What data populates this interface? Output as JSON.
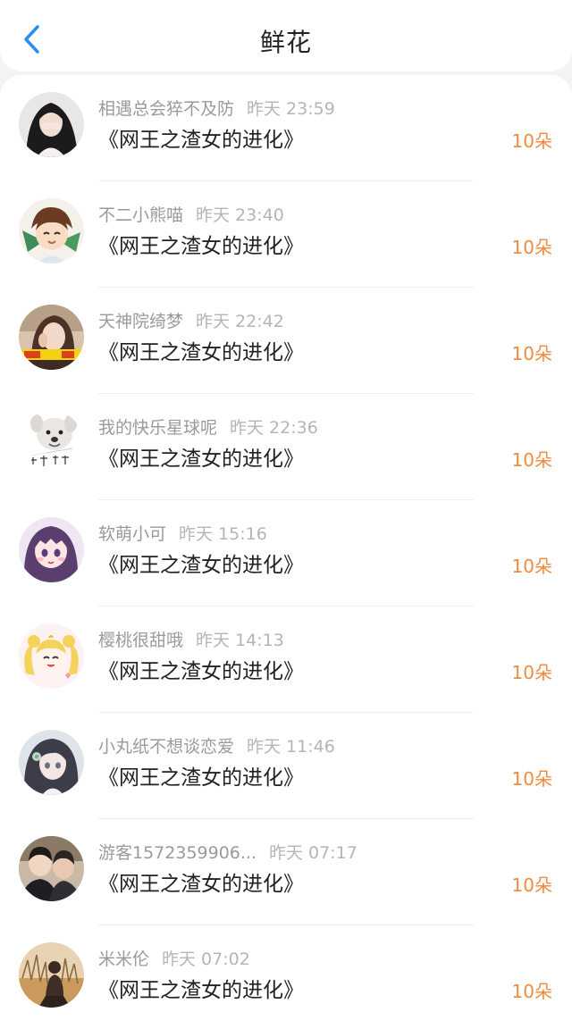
{
  "header": {
    "title": "鲜花",
    "back_icon": "chevron-left-icon",
    "accent_color": "#2a8ff0"
  },
  "records": [
    {
      "user": "相遇总会猝不及防",
      "time": "昨天 23:59",
      "book": "《网王之渣女的进化》",
      "count": "10朵"
    },
    {
      "user": "不二小熊喵",
      "time": "昨天 23:40",
      "book": "《网王之渣女的进化》",
      "count": "10朵"
    },
    {
      "user": "天神院绮梦",
      "time": "昨天 22:42",
      "book": "《网王之渣女的进化》",
      "count": "10朵"
    },
    {
      "user": "我的快乐星球呢",
      "time": "昨天 22:36",
      "book": "《网王之渣女的进化》",
      "count": "10朵"
    },
    {
      "user": "软萌小可",
      "time": "昨天 15:16",
      "book": "《网王之渣女的进化》",
      "count": "10朵"
    },
    {
      "user": "樱桃很甜哦",
      "time": "昨天 14:13",
      "book": "《网王之渣女的进化》",
      "count": "10朵"
    },
    {
      "user": "小丸纸不想谈恋爱",
      "time": "昨天 11:46",
      "book": "《网王之渣女的进化》",
      "count": "10朵"
    },
    {
      "user": "游客1572359906...",
      "time": "昨天 07:17",
      "book": "《网王之渣女的进化》",
      "count": "10朵"
    },
    {
      "user": "米米伦",
      "time": "昨天 07:02",
      "book": "《网王之渣女的进化》",
      "count": "10朵"
    }
  ],
  "colors": {
    "count": "#f08a3c",
    "name": "#9a9a9a",
    "time": "#b5b5b5",
    "text": "#222222"
  }
}
